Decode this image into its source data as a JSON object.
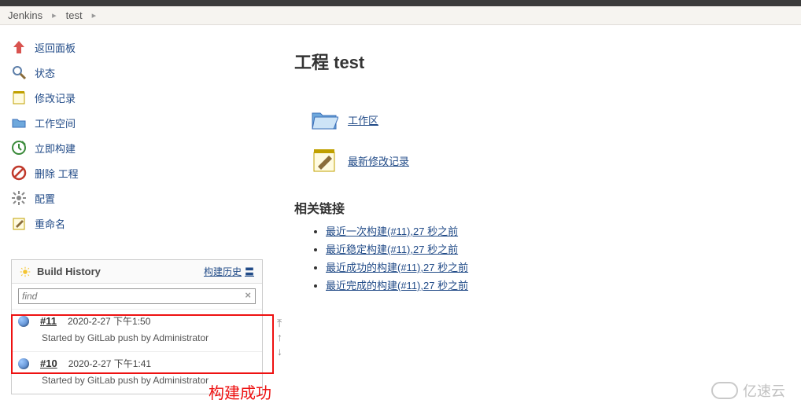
{
  "breadcrumb": {
    "root": "Jenkins",
    "project": "test"
  },
  "side": {
    "back": "返回面板",
    "status": "状态",
    "changes": "修改记录",
    "workspace": "工作空间",
    "build_now": "立即构建",
    "delete": "删除 工程",
    "configure": "配置",
    "rename": "重命名"
  },
  "build_history": {
    "title": "Build History",
    "trend": "构建历史",
    "search_placeholder": "find",
    "builds": [
      {
        "no": "#11",
        "time": "2020-2-27 下午1:50",
        "meta": "Started by GitLab push by Administrator"
      },
      {
        "no": "#10",
        "time": "2020-2-27 下午1:41",
        "meta": "Started by GitLab push by Administrator"
      }
    ]
  },
  "annotation": "构建成功",
  "main": {
    "heading": "工程 test",
    "workspace_link": "工作区",
    "changes_link": "最新修改记录",
    "related_heading": "相关链接",
    "related": [
      "最近一次构建(#11),27 秒之前",
      "最近稳定构建(#11),27 秒之前",
      "最近成功的构建(#11),27 秒之前",
      "最近完成的构建(#11),27 秒之前"
    ]
  },
  "watermark": "亿速云"
}
